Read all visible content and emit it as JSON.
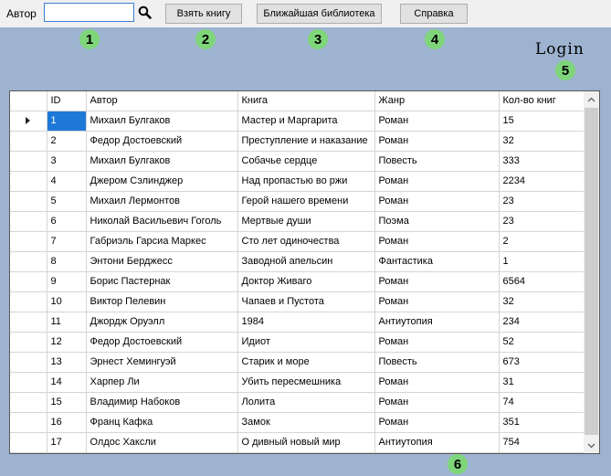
{
  "toolbar": {
    "author_label": "Автор",
    "search_value": "",
    "take_book": "Взять книгу",
    "nearest_library": "Ближайшая библиотека",
    "help": "Справка"
  },
  "badges": [
    "1",
    "2",
    "3",
    "4",
    "5",
    "6"
  ],
  "login_label": "Login",
  "grid": {
    "columns": [
      "ID",
      "Автор",
      "Книга",
      "Жанр",
      "Кол-во книг"
    ],
    "rows": [
      [
        "1",
        "Михаил Булгаков",
        "Мастер и Маргарита",
        "Роман",
        "15"
      ],
      [
        "2",
        "Федор  Достоевский",
        "Преступление и наказание",
        "Роман",
        "32"
      ],
      [
        "3",
        "Михаил Булгаков",
        "Собачье сердце",
        "Повесть",
        "333"
      ],
      [
        "4",
        "Джером Сэлинджер",
        "Над пропастью во ржи",
        "Роман",
        "2234"
      ],
      [
        "5",
        "Михаил Лермонтов",
        "Герой нашего времени",
        "Роман",
        "23"
      ],
      [
        "6",
        "Николай Васильевич Гоголь",
        "Мертвые души",
        "Поэма",
        "23"
      ],
      [
        "7",
        "Габриэль Гарсиа Маркес",
        "Сто лет одиночества",
        "Роман",
        "2"
      ],
      [
        "8",
        "Энтони Берджесс",
        "Заводной апельсин",
        "Фантастика",
        "1"
      ],
      [
        "9",
        "Борис Пастернак",
        "Доктор Живаго",
        "Роман",
        "6564"
      ],
      [
        "10",
        "Виктор Пелевин",
        "Чапаев и Пустота",
        "Роман",
        "32"
      ],
      [
        "11",
        "Джордж Оруэлл",
        "1984",
        "Антиутопия",
        "234"
      ],
      [
        "12",
        "Федор Достоевский",
        "Идиот",
        "Роман",
        "52"
      ],
      [
        "13",
        "Эрнест Хемингуэй",
        "Старик и море",
        "Повесть",
        "673"
      ],
      [
        "14",
        "Харпер Ли",
        "Убить пересмешника",
        "Роман",
        "31"
      ],
      [
        "15",
        "Владимир Набоков",
        "Лолита",
        "Роман",
        "74"
      ],
      [
        "16",
        "Франц Кафка",
        "Замок",
        "Роман",
        "351"
      ],
      [
        "17",
        "Олдос Хаксли",
        "О дивный новый мир",
        "Антиутопия",
        "754"
      ]
    ]
  },
  "colors": {
    "background": "#9db3cf",
    "selection": "#1e78d7",
    "badge": "#7fd67a"
  },
  "icons": {
    "search": "search-icon",
    "row_indicator": "row-indicator-arrow-icon",
    "scroll_up": "chevron-up-icon",
    "scroll_down": "chevron-down-icon"
  }
}
